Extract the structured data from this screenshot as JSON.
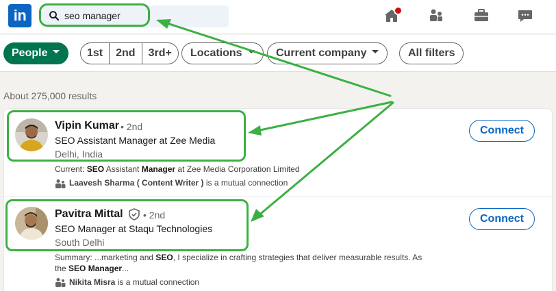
{
  "nav": {
    "logo": "in",
    "search_value": "seo manager",
    "icons": [
      "search-icon",
      "home-icon",
      "my-network-icon",
      "jobs-icon",
      "messaging-icon"
    ],
    "colors": {
      "brand": "#0a66c2",
      "notification": "#cc1016"
    }
  },
  "filters": {
    "people": "People",
    "first": "1st",
    "second": "2nd",
    "third": "3rd+",
    "locations": "Locations",
    "current_company": "Current company",
    "all_filters": "All filters",
    "active_color": "#01754f"
  },
  "results": {
    "count": "About 275,000 results",
    "items": [
      {
        "name": "Vipin Kumar",
        "degree": "• 2nd",
        "headline": "SEO Assistant Manager at Zee Media",
        "location": "Delhi, India",
        "snippet_prefix": "Current: ",
        "snippet_b1": "SEO",
        "snippet_mid1": " Assistant ",
        "snippet_b2": "Manager",
        "snippet_end": " at Zee Media Corporation Limited",
        "mutual_name": "Laavesh Sharma ( Content Writer )",
        "mutual_suffix": " is a mutual connection",
        "action": "Connect"
      },
      {
        "name": "Pavitra Mittal",
        "degree": "• 2nd",
        "headline": "SEO Manager at Staqu Technologies",
        "location": "South Delhi",
        "snippet_prefix": "Summary: ...marketing and ",
        "snippet_b1": "SEO",
        "snippet_end": ", I specialize in crafting strategies that deliver measurable results. As",
        "snippet_line2_prefix": "the ",
        "snippet_line2_b": "SEO Manager",
        "snippet_line2_end": "...",
        "mutual_name": "Nikita Misra",
        "mutual_suffix": " is a mutual connection",
        "action": "Connect"
      }
    ]
  },
  "annotation_color": "#3cb043"
}
